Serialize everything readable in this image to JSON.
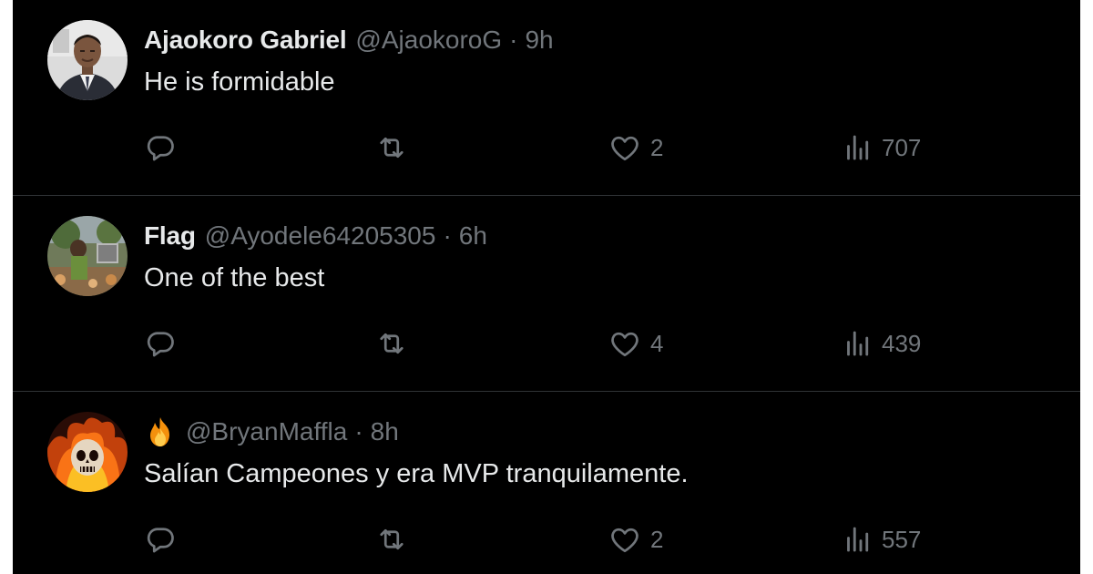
{
  "colors": {
    "background": "#000000",
    "primary_text": "#e7e9ea",
    "secondary_text": "#71767b",
    "divider": "#2f3336"
  },
  "replies": [
    {
      "display_name": "Ajaokoro Gabriel",
      "name_emoji": "",
      "handle": "@AjaokoroG",
      "separator": "·",
      "time": "9h",
      "text": "He is formidable",
      "like_count": "2",
      "view_count": "707",
      "avatar_icon": "profile-photo-man-in-suit"
    },
    {
      "display_name": "Flag",
      "name_emoji": "",
      "handle": "@Ayodele64205305",
      "separator": "·",
      "time": "6h",
      "text": "One of the best",
      "like_count": "4",
      "view_count": "439",
      "avatar_icon": "profile-photo-outdoor-scene"
    },
    {
      "display_name": "",
      "name_emoji": "fire-emoji",
      "handle": "@BryanMaffla",
      "separator": "·",
      "time": "8h",
      "text": "Salían Campeones y era MVP tranquilamente.",
      "like_count": "2",
      "view_count": "557",
      "avatar_icon": "profile-photo-flaming-skull"
    }
  ],
  "icons": {
    "reply": "reply-icon",
    "repost": "repost-icon",
    "like": "heart-icon",
    "views": "views-icon"
  }
}
